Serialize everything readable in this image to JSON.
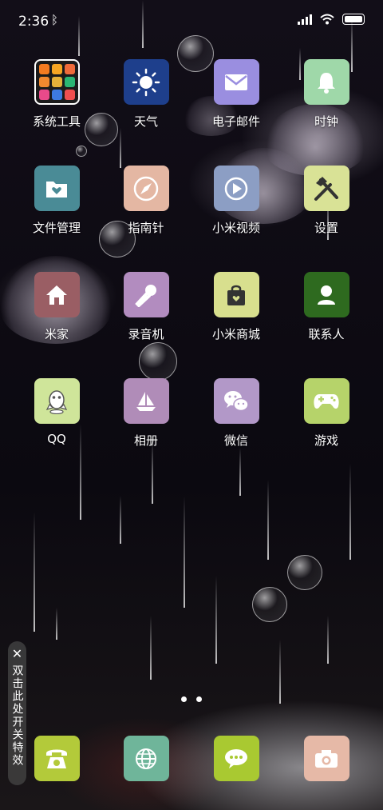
{
  "status_bar": {
    "time": "2:36"
  },
  "apps": [
    {
      "id": "system-tools",
      "label": "系统工具",
      "color": "#1b1b1b",
      "icon": "folder-icon"
    },
    {
      "id": "weather",
      "label": "天气",
      "color": "#1e3f8c",
      "icon": "sun-icon"
    },
    {
      "id": "email",
      "label": "电子邮件",
      "color": "#9a8ee0",
      "icon": "mail-icon"
    },
    {
      "id": "clock",
      "label": "时钟",
      "color": "#9fd8a9",
      "icon": "bell-icon"
    },
    {
      "id": "file-manager",
      "label": "文件管理",
      "color": "#4a8b96",
      "icon": "folder-heart-icon"
    },
    {
      "id": "compass",
      "label": "指南针",
      "color": "#e4b7a3",
      "icon": "compass-icon"
    },
    {
      "id": "mi-video",
      "label": "小米视频",
      "color": "#8c9ec4",
      "icon": "play-icon"
    },
    {
      "id": "settings",
      "label": "设置",
      "color": "#d9e296",
      "icon": "tools-icon"
    },
    {
      "id": "mi-home",
      "label": "米家",
      "color": "#9a5e64",
      "icon": "house-icon"
    },
    {
      "id": "recorder",
      "label": "录音机",
      "color": "#b28cbf",
      "icon": "microphone-icon"
    },
    {
      "id": "mi-store",
      "label": "小米商城",
      "color": "#d8df8e",
      "icon": "shopping-bag-icon"
    },
    {
      "id": "contacts",
      "label": "联系人",
      "color": "#2e6a1f",
      "icon": "person-icon"
    },
    {
      "id": "qq",
      "label": "QQ",
      "color": "#cfe59a",
      "icon": "penguin-icon"
    },
    {
      "id": "gallery",
      "label": "相册",
      "color": "#b08cb8",
      "icon": "sailboat-icon"
    },
    {
      "id": "wechat",
      "label": "微信",
      "color": "#b298c8",
      "icon": "chat-bubbles-icon"
    },
    {
      "id": "games",
      "label": "游戏",
      "color": "#b6d36a",
      "icon": "gamepad-icon"
    }
  ],
  "dock": [
    {
      "id": "phone",
      "color": "#b3ca3a",
      "icon": "telephone-icon"
    },
    {
      "id": "browser",
      "color": "#6fb59a",
      "icon": "globe-icon"
    },
    {
      "id": "messages",
      "color": "#a9c931",
      "icon": "message-icon"
    },
    {
      "id": "camera",
      "color": "#e6b9a7",
      "icon": "camera-icon"
    }
  ],
  "side_toggle": {
    "text": "双击此处开关特效"
  }
}
